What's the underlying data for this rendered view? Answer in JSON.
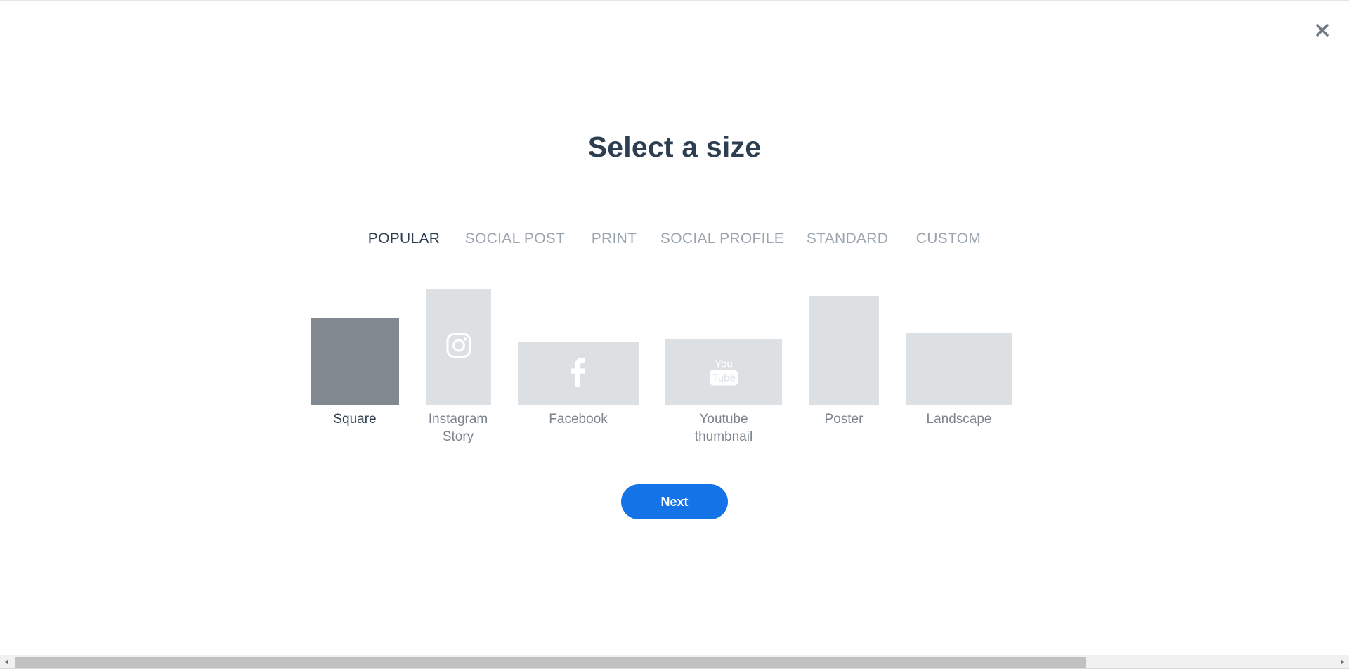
{
  "dialog": {
    "title": "Select a size",
    "close_icon": "close-icon"
  },
  "tabs": [
    {
      "label": "POPULAR",
      "active": true
    },
    {
      "label": "SOCIAL POST",
      "active": false
    },
    {
      "label": "PRINT",
      "active": false
    },
    {
      "label": "SOCIAL PROFILE",
      "active": false
    },
    {
      "label": "STANDARD",
      "active": false
    },
    {
      "label": "CUSTOM",
      "active": false
    }
  ],
  "sizes": [
    {
      "label_line1": "Square",
      "label_line2": "",
      "selected": true,
      "icon": ""
    },
    {
      "label_line1": "Instagram",
      "label_line2": "Story",
      "selected": false,
      "icon": "instagram-icon"
    },
    {
      "label_line1": "Facebook",
      "label_line2": "",
      "selected": false,
      "icon": "facebook-icon"
    },
    {
      "label_line1": "Youtube",
      "label_line2": "thumbnail",
      "selected": false,
      "icon": "youtube-icon"
    },
    {
      "label_line1": "Poster",
      "label_line2": "",
      "selected": false,
      "icon": ""
    },
    {
      "label_line1": "Landscape",
      "label_line2": "",
      "selected": false,
      "icon": ""
    }
  ],
  "youtube_icon_text": {
    "top": "You",
    "bottom": "Tube"
  },
  "next_button": {
    "label": "Next"
  },
  "colors": {
    "title": "#2c3e50",
    "tab_inactive": "#9aa4ae",
    "thumb": "#dde0e3",
    "thumb_selected": "#82888f",
    "primary": "#1473e6"
  }
}
